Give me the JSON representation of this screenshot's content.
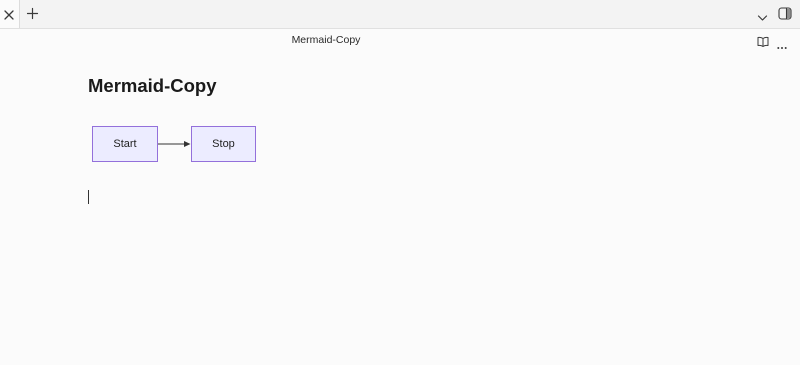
{
  "window": {
    "tab_close_icon": "close-icon",
    "new_tab_icon": "plus-icon",
    "tab_list_icon": "chevron-down-icon",
    "sidebar_icon": "sidebar-toggle-icon"
  },
  "view_header": {
    "title": "Mermaid-Copy",
    "reading_view_icon": "book-open-icon",
    "more_options_icon": "more-horizontal-icon"
  },
  "note": {
    "title": "Mermaid-Copy",
    "diagram": {
      "type": "flowchart",
      "nodes": [
        {
          "id": "start",
          "label": "Start"
        },
        {
          "id": "stop",
          "label": "Stop"
        }
      ],
      "edges": [
        {
          "from": "start",
          "to": "stop"
        }
      ],
      "node_fill": "#ececff",
      "node_stroke": "#9370db"
    }
  },
  "colors": {
    "background": "#fbfbfb",
    "tabbar": "#f3f3f3",
    "text": "#1a1a1a"
  }
}
